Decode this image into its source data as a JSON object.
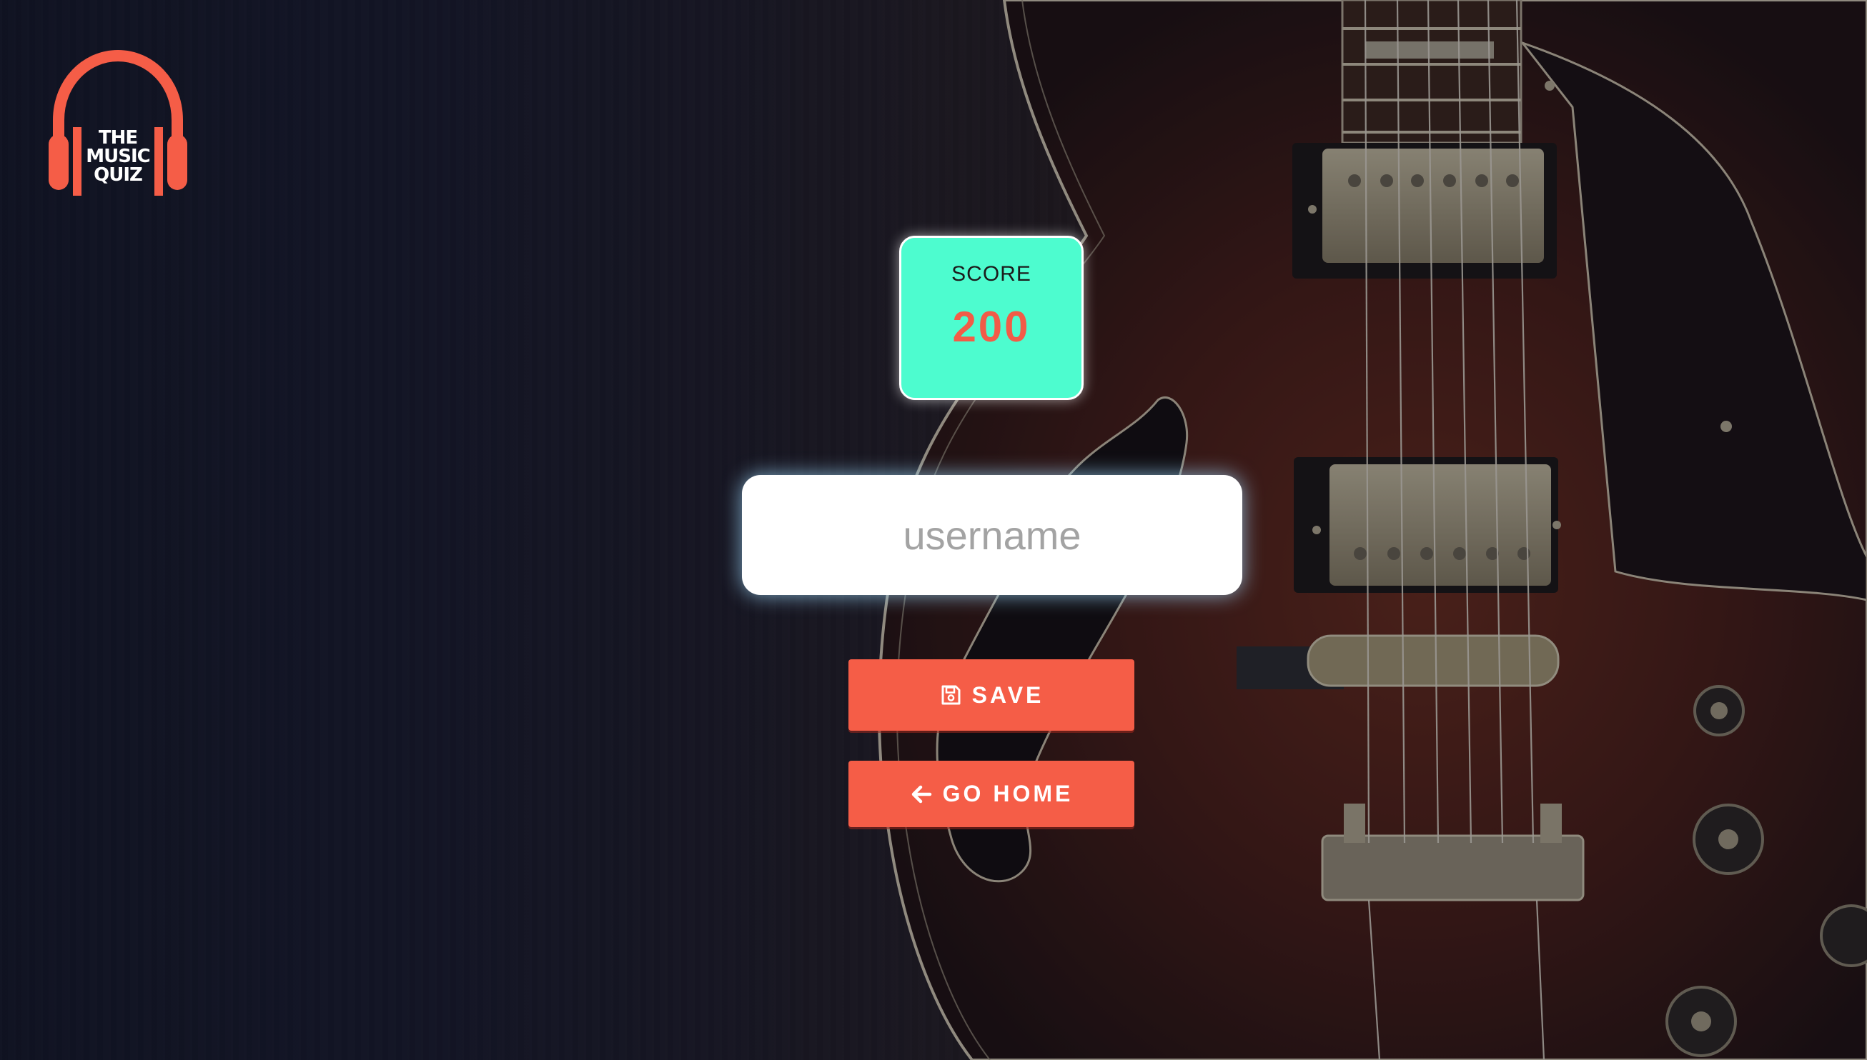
{
  "app": {
    "logo_text": [
      "THE",
      "MUSIC",
      "QUIZ"
    ],
    "logo_icon": "headphones-icon"
  },
  "score": {
    "label": "SCORE",
    "value": "200"
  },
  "username": {
    "placeholder": "username",
    "value": ""
  },
  "actions": {
    "save_label": "SAVE",
    "save_icon": "floppy-disk-icon",
    "home_label": "GO HOME",
    "home_icon": "arrow-left-icon"
  },
  "colors": {
    "accent": "#f55d47",
    "score_card": "#4dfccf",
    "score_value": "#f25c47",
    "input_bg": "#ffffff"
  }
}
